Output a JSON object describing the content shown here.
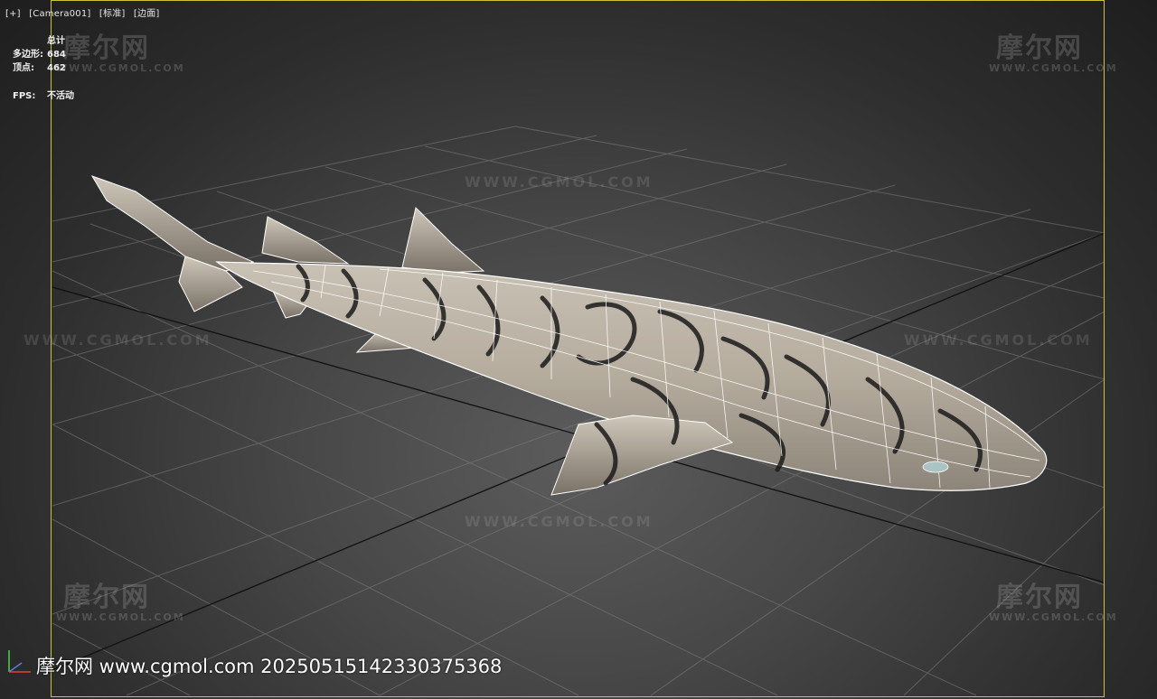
{
  "viewport": {
    "menu": [
      "[+]",
      "[Camera001]",
      "[标准]",
      "[边面]"
    ]
  },
  "stats": {
    "header": "总计",
    "polygons_label": "多边形:",
    "polygons_value": "684",
    "vertices_label": "顶点:",
    "vertices_value": "462",
    "fps_label": "FPS:",
    "fps_value": "不活动"
  },
  "watermark": {
    "cn": "摩尔网",
    "en": "WWW.CGMOL.COM",
    "url": "WWW.CGMOL.COM"
  },
  "footer": {
    "text": "摩尔网 www.cgmol.com 20250515142330375368"
  },
  "colors": {
    "frame": "#c9c33a",
    "background": "#474747",
    "wire": "#ffffff"
  },
  "icons": {
    "axis": "axis-gizmo-icon"
  }
}
